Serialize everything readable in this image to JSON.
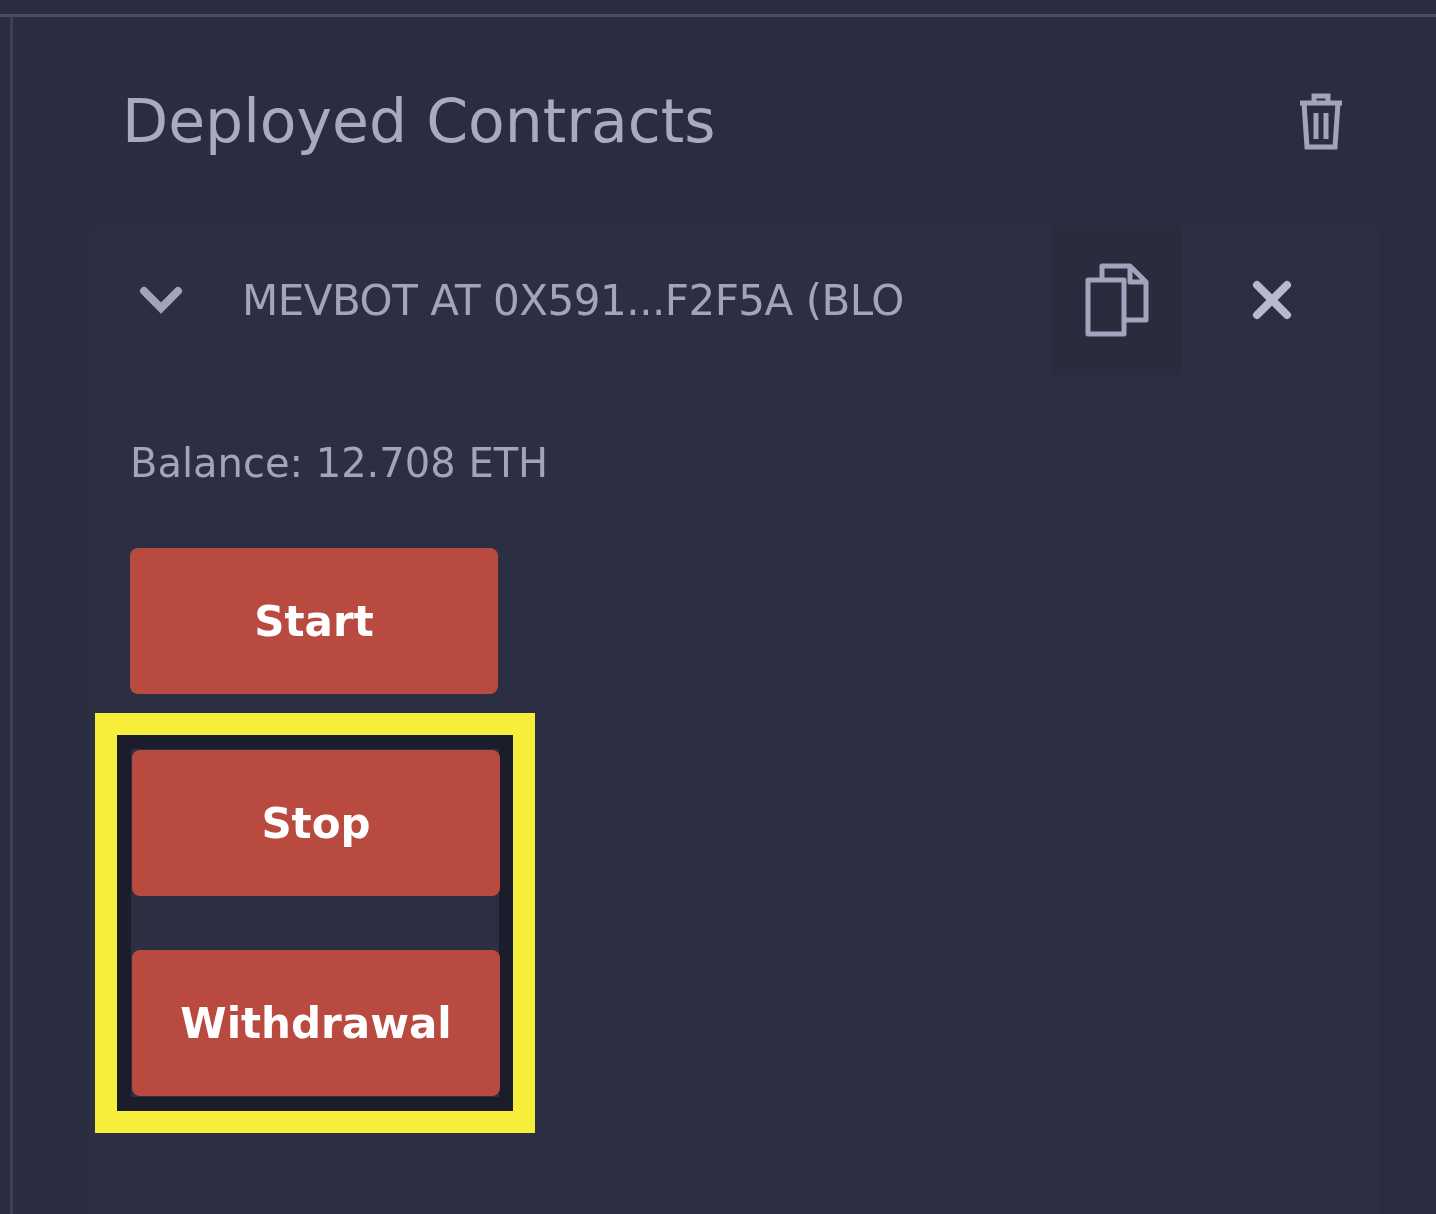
{
  "panel": {
    "title": "Deployed Contracts"
  },
  "contract": {
    "expanded": true,
    "name": "MEVBOT AT 0X591...F2F5A (BLO",
    "balance": "Balance: 12.708 ETH",
    "functions": [
      {
        "label": "Start",
        "highlighted": false
      },
      {
        "label": "Stop",
        "highlighted": true
      },
      {
        "label": "Withdrawal",
        "highlighted": true
      }
    ]
  }
}
